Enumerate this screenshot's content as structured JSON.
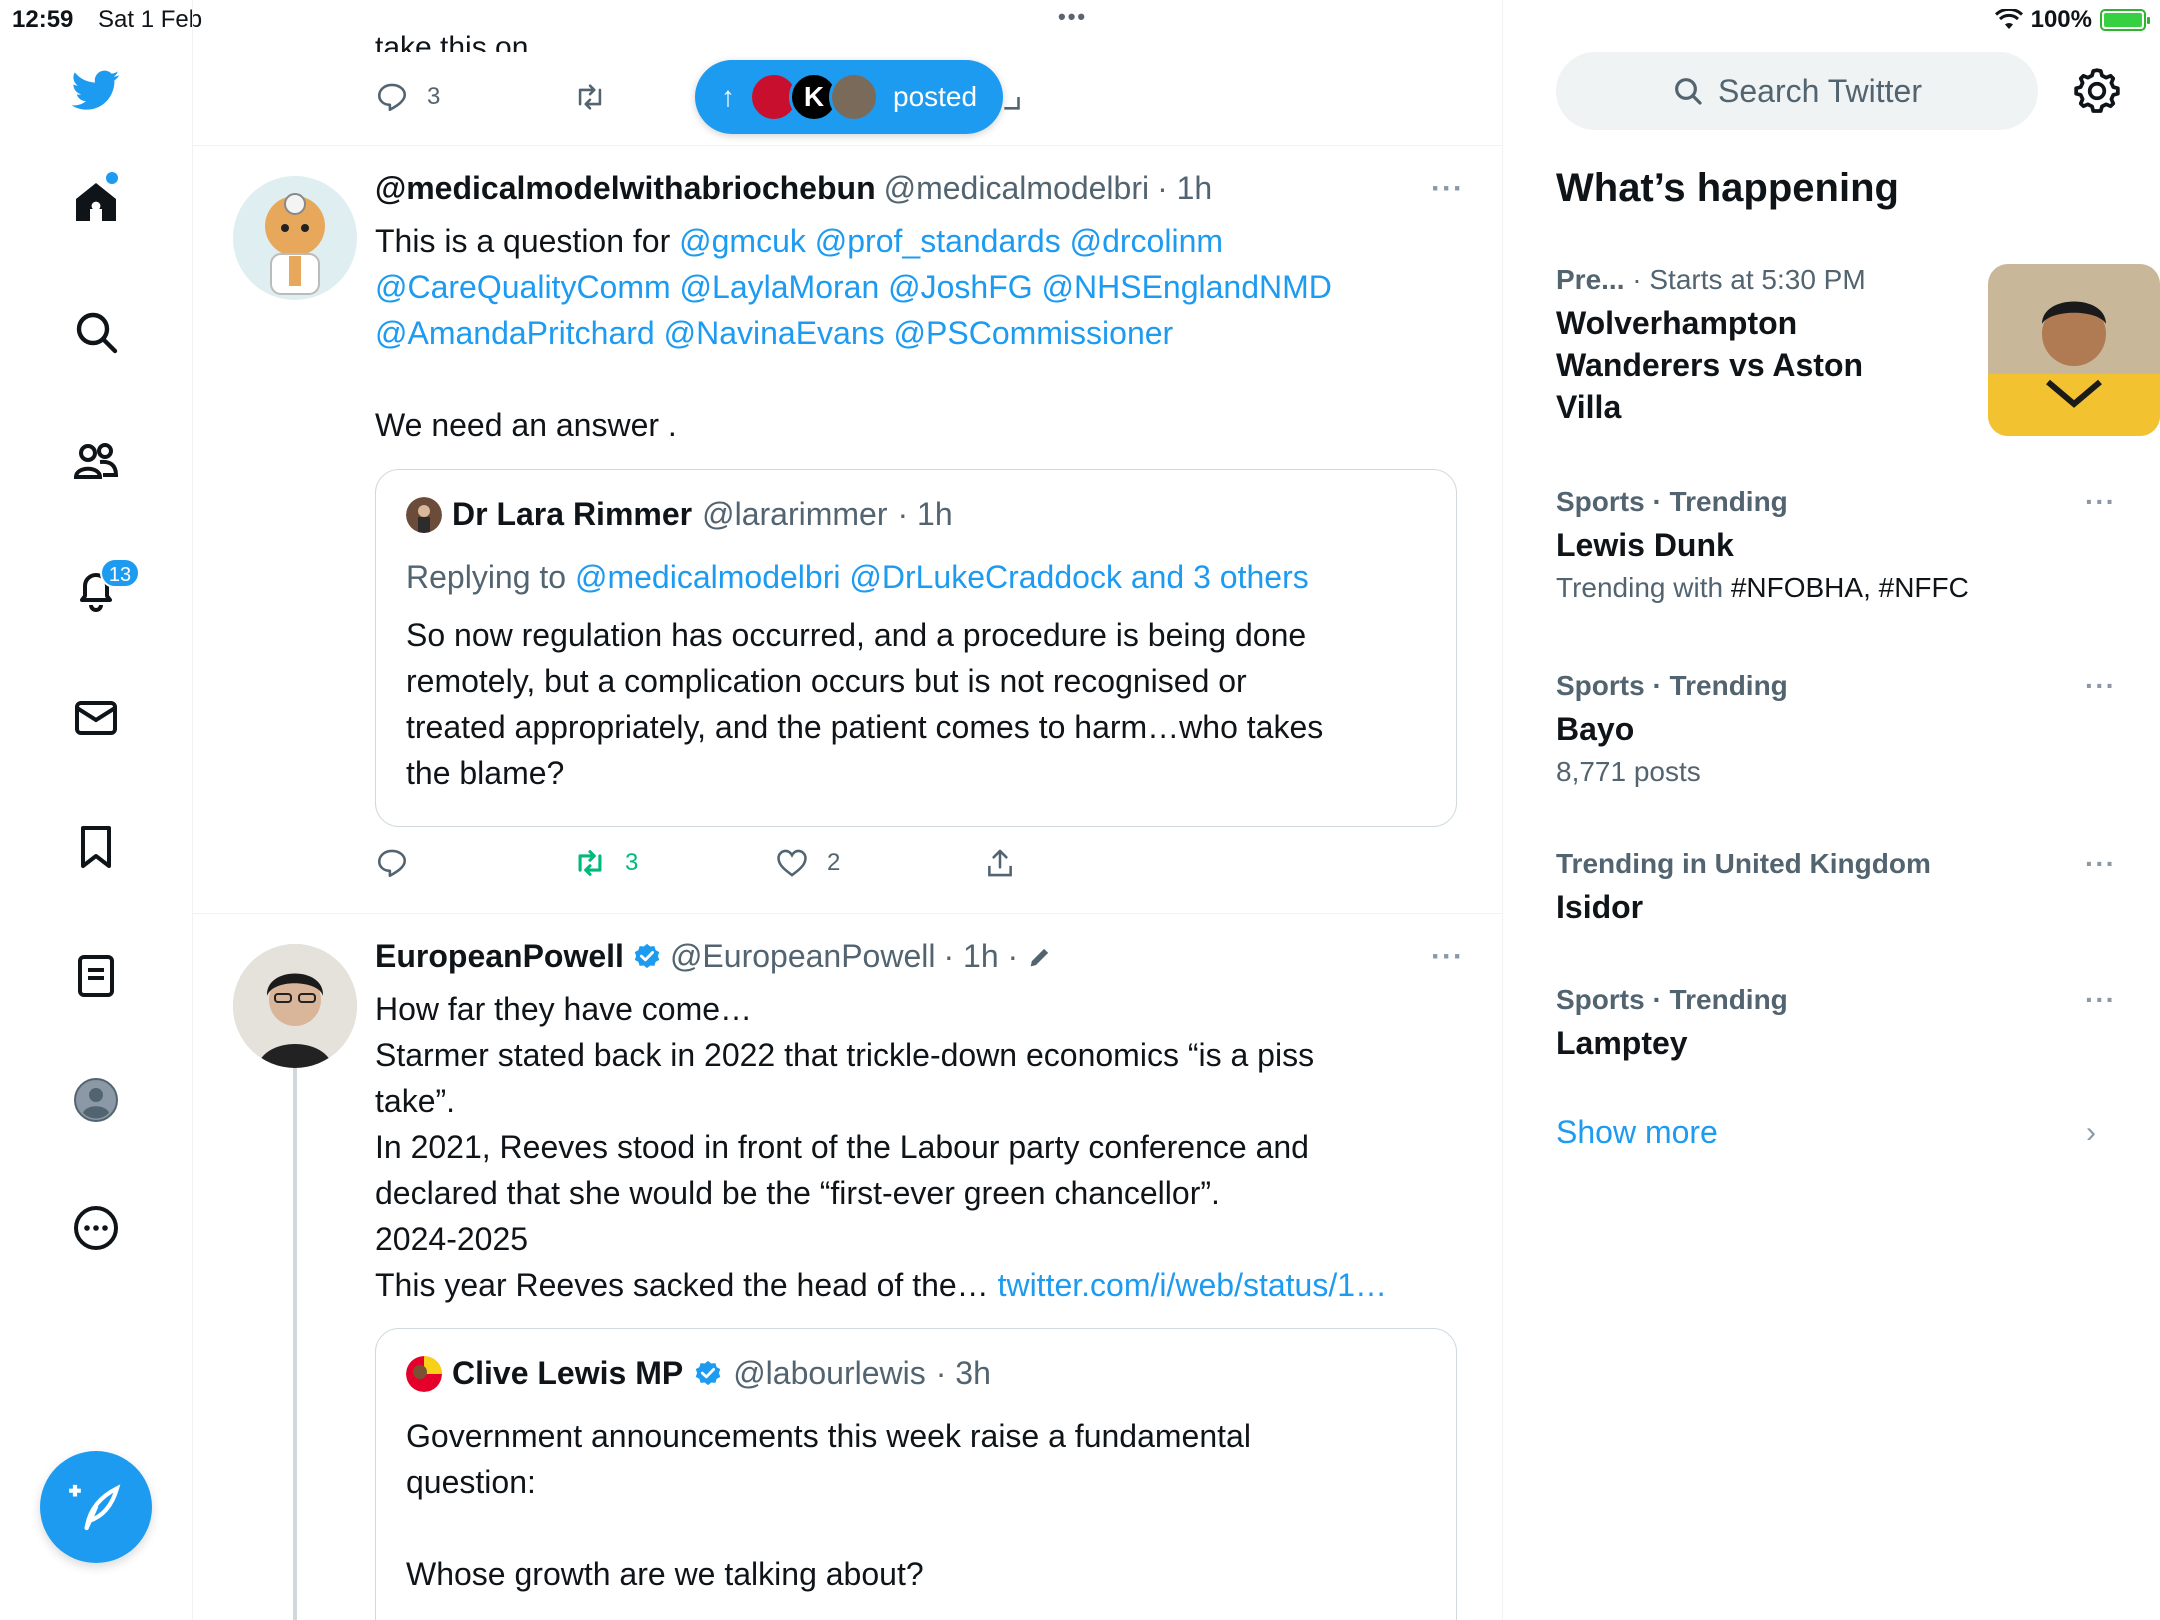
{
  "status_bar": {
    "time": "12:59",
    "date": "Sat 1 Feb",
    "battery": "100%"
  },
  "nav": {
    "notification_count": "13"
  },
  "top_tweet": {
    "cut_text": "take this on...",
    "reply_count": "3"
  },
  "new_posts_pill": {
    "arrow": "↑",
    "label": "posted",
    "avatar_letter": "K"
  },
  "tweet1": {
    "name": "@medicalmodelwithabriochebun",
    "handle": "@medicalmodelbri",
    "time": "· 1h",
    "more": "···",
    "intro": "This is a question for",
    "mentions_line1": "@gmcuk @prof_standards @drcolinm",
    "mentions_line2": "@CareQualityComm @LaylaMoran @JoshFG @NHSEnglandNMD",
    "mentions_line3": "@AmandaPritchard @NavinaEvans @PSCommissioner",
    "closing": "We need an answer .",
    "quote": {
      "name": "Dr Lara Rimmer",
      "handle": "@lararimmer",
      "time": "· 1h",
      "replying_prefix": "Replying to",
      "replying_to": "@medicalmodelbri @DrLukeCraddock and 3 others",
      "line1": "So now regulation has occurred, and a procedure is being done",
      "line2": "remotely, but a complication occurs but is not recognised or",
      "line3": "treated appropriately, and the patient comes to harm…who takes",
      "line4": "the blame?"
    },
    "retweets": "3",
    "likes": "2"
  },
  "tweet2": {
    "name": "EuropeanPowell",
    "handle": "@EuropeanPowell",
    "time": "· 1h ·",
    "more": "···",
    "line1": "How far they have come…",
    "line2": "Starmer stated back in 2022 that trickle-down economics “is a piss",
    "line3": "take”.",
    "line4": "In 2021, Reeves stood in front of the Labour party conference and",
    "line5": "declared that she would be the “first-ever green chancellor”.",
    "line6": "2024-2025",
    "line7": "This year Reeves sacked the head of the…",
    "link": "twitter.com/i/web/status/1…",
    "quote": {
      "name": "Clive Lewis MP",
      "handle": "@labourlewis",
      "time": "· 3h",
      "line1": "Government announcements this week raise a fundamental",
      "line2": "question:",
      "line3": "Whose growth are we talking about?"
    }
  },
  "right": {
    "search_placeholder": "Search Twitter",
    "section_title": "What’s happening",
    "trends": [
      {
        "meta": "Pre...",
        "meta2": "· Starts at 5:30 PM",
        "title_line1": "Wolverhampton",
        "title_line2": "Wanderers vs Aston",
        "title_line3": "Villa"
      },
      {
        "meta": "Sports · Trending",
        "title": "Lewis Dunk",
        "sub_prefix": "Trending with",
        "sub_tags": "#NFOBHA, #NFFC"
      },
      {
        "meta": "Sports · Trending",
        "title": "Bayo",
        "sub": "8,771 posts"
      },
      {
        "meta": "Trending in United Kingdom",
        "title": "Isidor"
      },
      {
        "meta": "Sports · Trending",
        "title": "Lamptey"
      }
    ],
    "more_dots": "···",
    "show_more": "Show more"
  },
  "colors": {
    "accent": "#1d9bf0",
    "retweet_green": "#00ba7c",
    "secondary_text": "#536471"
  }
}
